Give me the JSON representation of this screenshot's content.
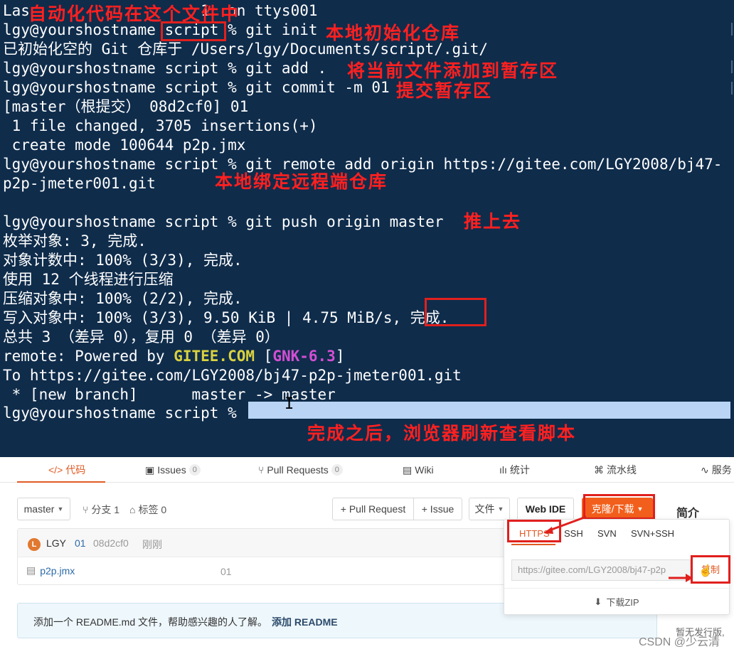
{
  "terminal": {
    "lines": [
      "Las                   1  on ttys001",
      "lgy@yourshostname script % git init ",
      "已初始化空的 Git 仓库于 /Users/lgy/Documents/script/.git/",
      "lgy@yourshostname script % git add .",
      "lgy@yourshostname script % git commit -m 01",
      "[master（根提交） 08d2cf0] 01",
      " 1 file changed, 3705 insertions(+)",
      " create mode 100644 p2p.jmx",
      "lgy@yourshostname script % git remote add origin https://gitee.com/LGY2008/bj47-",
      "p2p-jmeter001.git",
      "",
      "lgy@yourshostname script % git push origin master",
      "枚举对象: 3, 完成.",
      "对象计数中: 100% (3/3), 完成.",
      "使用 12 个线程进行压缩",
      "压缩对象中: 100% (2/2), 完成.",
      "写入对象中: 100% (3/3), 9.50 KiB | 4.75 MiB/s, 完成.",
      "总共 3 （差异 0），复用 0 （差异 0）",
      "remote: Powered by ",
      "To https://gitee.com/LGY2008/bj47-p2p-jmeter001.git",
      " * [new branch]      master -> master",
      "lgy@yourshostname script % "
    ],
    "remote_brand": "GITEE.COM",
    "remote_ver_open": " [",
    "remote_ver": "GNK-6.3",
    "remote_ver_close": "]"
  },
  "annotations": {
    "a1": "自动化代码在这个文件中",
    "a2": "本地初始化仓库",
    "a3": "将当前文件添加到暂存区",
    "a4": "提交暂存区",
    "a5": "本地绑定远程端仓库",
    "a6": "推上去",
    "a7": "完成之后，浏览器刷新查看脚本"
  },
  "gitee": {
    "tabs": [
      {
        "label": "代码",
        "icon": "code-icon"
      },
      {
        "label": "Issues",
        "count": "0"
      },
      {
        "label": "Pull Requests",
        "count": "0"
      },
      {
        "label": "Wiki"
      },
      {
        "label": "统计"
      },
      {
        "label": "流水线"
      },
      {
        "label": "服务"
      }
    ],
    "branch": "master",
    "branch_count": "分支 1",
    "tag_count": "标签 0",
    "pull_request_btn": "+ Pull Request",
    "issue_btn": "+ Issue",
    "file_btn": "文件",
    "web_ide_btn": "Web IDE",
    "clone_btn": "克隆/下载",
    "intro": "简介",
    "commit": {
      "avatar": "L",
      "author": "LGY",
      "message": "01",
      "hash": "08d2cf0",
      "time": "刚刚"
    },
    "file": {
      "name": "p2p.jmx",
      "commit_msg": "01"
    },
    "readme_text": "添加一个 README.md 文件，帮助感兴趣的人了解。",
    "readme_link": "添加 README",
    "clone_pop": {
      "protocols": [
        "HTTPS",
        "SSH",
        "SVN",
        "SVN+SSH"
      ],
      "url": "https://gitee.com/LGY2008/bj47-p2p",
      "copy": "复制",
      "zip": "下载ZIP"
    },
    "no_release": "暂无发行版,",
    "watermark": "CSDN @少云清"
  },
  "colors": {
    "terminal_bg": "#0f2c4b",
    "annotation_red": "#ff2020",
    "gitee_orange": "#f25f1c"
  }
}
